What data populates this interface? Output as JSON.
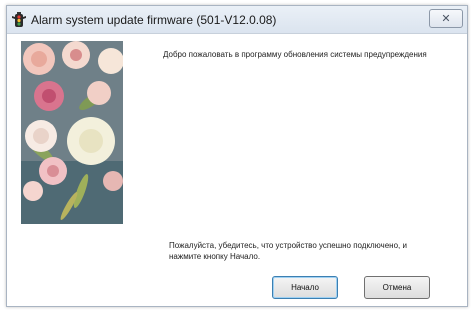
{
  "window": {
    "title": "Alarm system update firmware (501-V12.0.08)",
    "icon": "traffic-light-icon",
    "close_glyph": "✕"
  },
  "content": {
    "welcome_text": "Добро пожаловать в программу обновления системы предупреждения",
    "instruction_text": "Пожалуйста, убедитесь, что устройство успешно подключено, и нажмите кнопку Начало."
  },
  "buttons": {
    "start_label": "Начало",
    "cancel_label": "Отмена"
  },
  "side_image": {
    "subject": "flower-bouquet-image"
  }
}
